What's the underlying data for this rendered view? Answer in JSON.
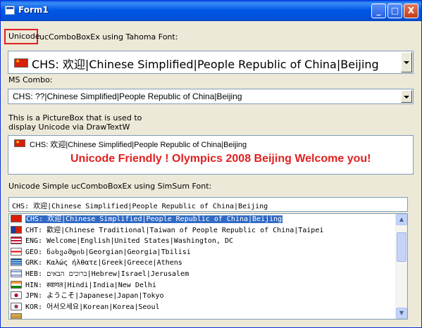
{
  "window": {
    "title": "Form1"
  },
  "title_buttons": {
    "minimize": "_",
    "maximize": "□",
    "close": "X"
  },
  "labels": {
    "unicode_word": "Unicode",
    "unicode_rest": "ucComboBoxEx using Tahoma Font:",
    "ms_combo": "MS Combo:",
    "picturebox_line1": "This is a PictureBox that is used to",
    "picturebox_line2": "display Unicode via DrawTextW",
    "simsun": "Unicode Simple ucComboBoxEx using SimSum Font:"
  },
  "combo_tahoma": {
    "value": "CHS: 欢迎|Chinese Simplified|People Republic of China|Beijing",
    "flag": "china-flag"
  },
  "ms_combo": {
    "value": "CHS: ??|Chinese Simplified|People Republic of China|Beijing"
  },
  "picturebox": {
    "line": "CHS: 欢迎|Chinese Simplified|People Republic of China|Beijing",
    "message": "Unicode Friendly ! Olympics 2008 Beijing Welcome you!",
    "message_color": "#e02020"
  },
  "simsun_combo": {
    "value": "CHS: 欢迎|Chinese Simplified|People Republic of China|Beijing"
  },
  "list": {
    "items": [
      {
        "text": "CHS: 欢迎|Chinese Simplified|People Republic of China|Beijing",
        "flag": "china-flag",
        "selected": true
      },
      {
        "text": "CHT: 歡迎|Chinese Traditional|Taiwan of People Republic of China|Taipei",
        "flag": "taiwan-flag",
        "selected": false
      },
      {
        "text": "ENG: Welcome|English|United States|Washington, DC",
        "flag": "usa-flag",
        "selected": false
      },
      {
        "text": "GEO: ნახვამდის|Georgian|Georgia|Tbilisi",
        "flag": "georgia-flag",
        "selected": false
      },
      {
        "text": "GRK: Καλώς ήλθατε|Greek|Greece|Athens",
        "flag": "greece-flag",
        "selected": false
      },
      {
        "text": "HEB: ברוכים הבאים|Hebrew|Israel|Jerusalem",
        "flag": "israel-flag",
        "selected": false
      },
      {
        "text": "HIN: स्वागत|Hindi|India|New Delhi",
        "flag": "india-flag",
        "selected": false
      },
      {
        "text": "JPN: ようこそ|Japanese|Japan|Tokyo",
        "flag": "japan-flag",
        "selected": false
      },
      {
        "text": "KOR: 어서오세요|Korean|Korea|Seoul",
        "flag": "korea-flag",
        "selected": false
      },
      {
        "text": "",
        "flag": "flag",
        "selected": false
      }
    ]
  },
  "colors": {
    "selection": "#316ac5",
    "highlight_box": "#e02020"
  }
}
